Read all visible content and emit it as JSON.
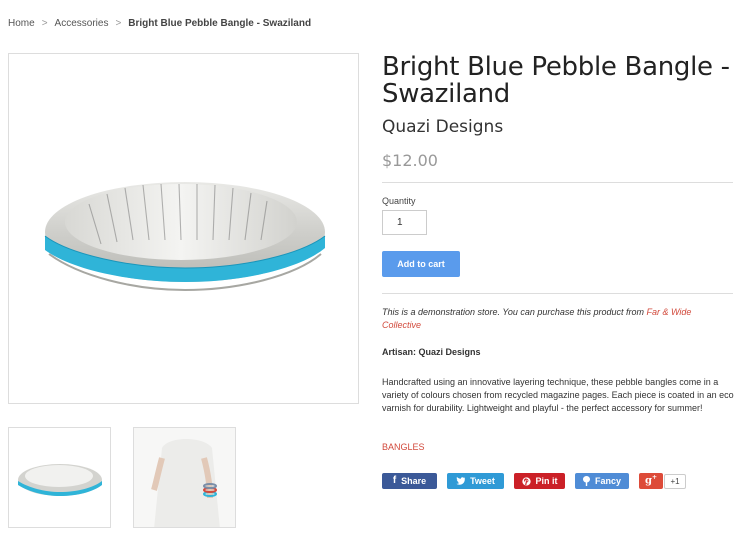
{
  "breadcrumb": {
    "home": "Home",
    "separator": ">",
    "accessories": "Accessories",
    "current": "Bright Blue Pebble Bangle - Swaziland"
  },
  "product": {
    "title": "Bright Blue Pebble Bangle - Swaziland",
    "vendor": "Quazi Designs",
    "price": "$12.00",
    "quantity_label": "Quantity",
    "quantity_value": "1",
    "add_to_cart": "Add to cart",
    "demo_note_text": "This is a demonstration store. You can purchase this product from ",
    "demo_note_link": "Far & Wide Collective",
    "artisan": "Artisan: Quazi Designs",
    "description": "Handcrafted using an innovative layering technique, these pebble bangles come in a variety of colours chosen from recycled magazine pages. Each piece is coated in an eco varnish for durability. Lightweight and playful - the perfect accessory for summer!",
    "tag": "BANGLES"
  },
  "social": {
    "facebook": "Share",
    "twitter": "Tweet",
    "pinterest": "Pin it",
    "fancy": "Fancy",
    "gplus_count": "+1"
  },
  "colors": {
    "accent_button": "#5a9bec",
    "link_red": "#d24a3c",
    "facebook": "#3b5998",
    "twitter": "#2f9ad6",
    "pinterest": "#cb2027",
    "fancy": "#4f8cd6",
    "gplus": "#dd4b39",
    "bangle_blue": "#2fb4d8"
  },
  "icons": [
    "facebook-icon",
    "twitter-icon",
    "pinterest-icon",
    "fancy-icon",
    "gplus-icon"
  ]
}
